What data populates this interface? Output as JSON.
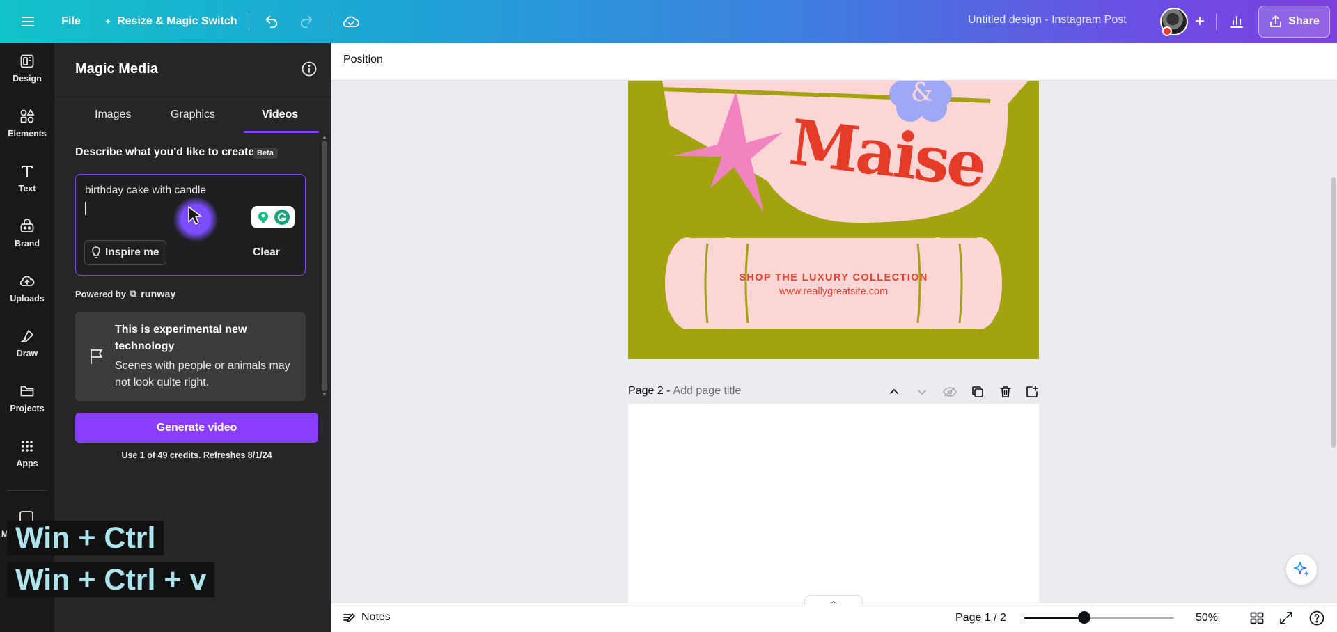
{
  "topbar": {
    "file_label": "File",
    "resize_label": "Resize & Magic Switch",
    "doc_title": "Untitled design - Instagram Post",
    "share_label": "Share"
  },
  "rail": {
    "items": [
      {
        "label": "Design",
        "icon": "design-icon"
      },
      {
        "label": "Elements",
        "icon": "elements-icon"
      },
      {
        "label": "Text",
        "icon": "text-icon"
      },
      {
        "label": "Brand",
        "icon": "brand-icon"
      },
      {
        "label": "Uploads",
        "icon": "uploads-icon"
      },
      {
        "label": "Draw",
        "icon": "draw-icon"
      },
      {
        "label": "Projects",
        "icon": "projects-icon"
      },
      {
        "label": "Apps",
        "icon": "apps-icon"
      }
    ],
    "peek_label": "M"
  },
  "panel": {
    "title": "Magic Media",
    "tabs": [
      "Images",
      "Graphics",
      "Videos"
    ],
    "active_tab": "Videos",
    "describe_label": "Describe what you'd like to create",
    "beta_label": "Beta",
    "prompt_value": "birthday cake with candle",
    "inspire_label": "Inspire me",
    "clear_label": "Clear",
    "powered_by": "Powered by",
    "powered_brand": "runway",
    "note_title": "This is experimental new technology",
    "note_body": "Scenes with people or animals may not look quite right.",
    "generate_label": "Generate video",
    "credits_text": "Use 1 of 49 credits. Refreshes 8/1/24"
  },
  "shortcuts": {
    "line1": "Win + Ctrl",
    "line2": "Win + Ctrl + v"
  },
  "context_bar": {
    "position_label": "Position"
  },
  "canvas": {
    "page1": {
      "headline": "Maise",
      "shop_text": "SHOP THE LUXURY COLLECTION",
      "site_text": "www.reallygreatsite.com",
      "ampersand": "&"
    },
    "page2": {
      "label": "Page 2 -",
      "title_placeholder": "Add page title"
    }
  },
  "bottombar": {
    "notes_label": "Notes",
    "page_count": "Page 1 / 2",
    "zoom_pct": "50%",
    "zoom_value": 0.4
  },
  "colors": {
    "accent": "#8b3dff",
    "page_bg": "#a3a20f",
    "pink": "#fcd6d6",
    "red": "#e43c27",
    "star": "#f183c1",
    "flower": "#9ea8f5"
  }
}
